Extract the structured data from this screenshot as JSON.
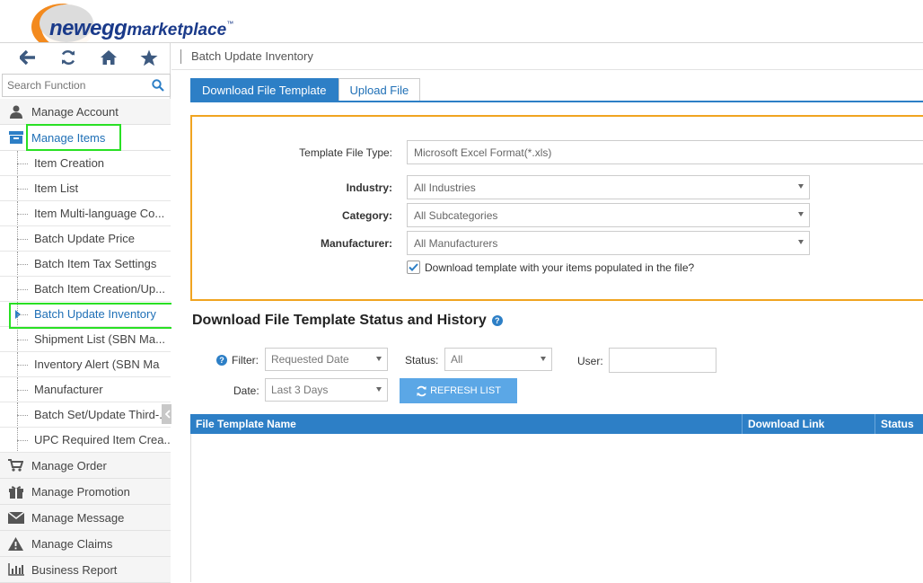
{
  "logo": {
    "brand": "newegg",
    "product": "marketplace",
    "tm": "™"
  },
  "sidebar": {
    "search_placeholder": "Search Function",
    "menu": [
      {
        "label": "Manage Account",
        "icon": "user-icon"
      },
      {
        "label": "Manage Items",
        "icon": "box-icon"
      },
      {
        "label": "Manage Order",
        "icon": "cart-icon"
      },
      {
        "label": "Manage Promotion",
        "icon": "gift-icon"
      },
      {
        "label": "Manage Message",
        "icon": "envelope-icon"
      },
      {
        "label": "Manage Claims",
        "icon": "warning-icon"
      },
      {
        "label": "Business Report",
        "icon": "bar-chart-icon"
      }
    ],
    "subitems": [
      "Item Creation",
      "Item List",
      "Item Multi-language Co...",
      "Batch Update Price",
      "Batch Item Tax Settings",
      "Batch Item Creation/Up...",
      "Batch Update Inventory",
      "Shipment List (SBN Ma...",
      "Inventory Alert (SBN Ma",
      "Manufacturer",
      "Batch Set/Update Third-...",
      "UPC Required Item Crea..."
    ]
  },
  "breadcrumb": "Batch Update Inventory",
  "tabs": [
    "Download File Template",
    "Upload File"
  ],
  "form": {
    "template_type_label": "Template File Type:",
    "template_type_value": "Microsoft Excel Format(*.xls)",
    "industry_label": "Industry:",
    "industry_value": "All Industries",
    "category_label": "Category:",
    "category_value": "All Subcategories",
    "manufacturer_label": "Manufacturer:",
    "manufacturer_value": "All Manufacturers",
    "checkbox_label": "Download template with your items populated in the file?",
    "checkbox_checked": true
  },
  "history": {
    "title": "Download File Template Status and History",
    "filter_label": "Filter:",
    "filter_value": "Requested Date",
    "status_label": "Status:",
    "status_value": "All",
    "user_label": "User:",
    "user_value": "",
    "date_label": "Date:",
    "date_value": "Last 3 Days",
    "refresh_label": "REFRESH LIST",
    "columns": [
      "File Template Name",
      "Download Link",
      "Status"
    ]
  }
}
